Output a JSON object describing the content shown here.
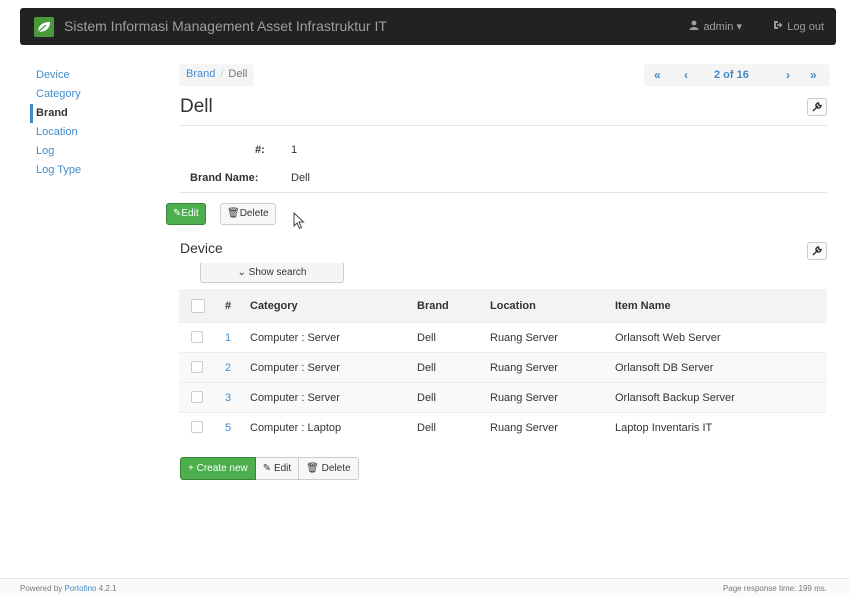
{
  "navbar": {
    "title": "Sistem Informasi Management Asset Infrastruktur IT",
    "user_label": "admin",
    "user_icon": "user-icon",
    "logout_label": "Log out",
    "logout_icon": "logout-icon"
  },
  "sidebar": {
    "items": [
      {
        "label": "Device"
      },
      {
        "label": "Category"
      },
      {
        "label": "Brand"
      },
      {
        "label": "Location"
      },
      {
        "label": "Log"
      },
      {
        "label": "Log Type"
      }
    ]
  },
  "breadcrumb": {
    "parent": "Brand",
    "separator": "/",
    "current": "Dell"
  },
  "pager": {
    "first": "«",
    "prev": "‹",
    "info": "2 of 16",
    "next": "›",
    "last": "»"
  },
  "page_title": "Dell",
  "details": {
    "id_label": "#:",
    "id_value": "1",
    "name_label": "Brand Name:",
    "name_value": "Dell"
  },
  "actions": {
    "edit_label": "Edit",
    "delete_label": "Delete"
  },
  "device_section": {
    "title": "Device",
    "show_search_label": "Show search"
  },
  "table": {
    "headers": {
      "num": "#",
      "category": "Category",
      "brand": "Brand",
      "location": "Location",
      "item_name": "Item Name"
    },
    "rows": [
      {
        "num": "1",
        "category": "Computer : Server",
        "brand": "Dell",
        "location": "Ruang Server",
        "item_name": "Orlansoft Web Server"
      },
      {
        "num": "2",
        "category": "Computer : Server",
        "brand": "Dell",
        "location": "Ruang Server",
        "item_name": "Orlansoft DB Server"
      },
      {
        "num": "3",
        "category": "Computer : Server",
        "brand": "Dell",
        "location": "Ruang Server",
        "item_name": "Orlansoft Backup Server"
      },
      {
        "num": "5",
        "category": "Computer : Laptop",
        "brand": "Dell",
        "location": "Ruang Server",
        "item_name": "Laptop Inventaris IT"
      }
    ]
  },
  "table_actions": {
    "create_label": "Create new",
    "edit_label": "Edit",
    "delete_label": "Delete"
  },
  "footer": {
    "powered_prefix": "Powered by",
    "powered_link": "Portofino",
    "version": "4.2.1",
    "response_time": "Page response time: 199 ms."
  },
  "colors": {
    "navbar_bg": "#222222",
    "link": "#428bca",
    "success": "#4cae4c",
    "logo": "#4a9a3c"
  }
}
